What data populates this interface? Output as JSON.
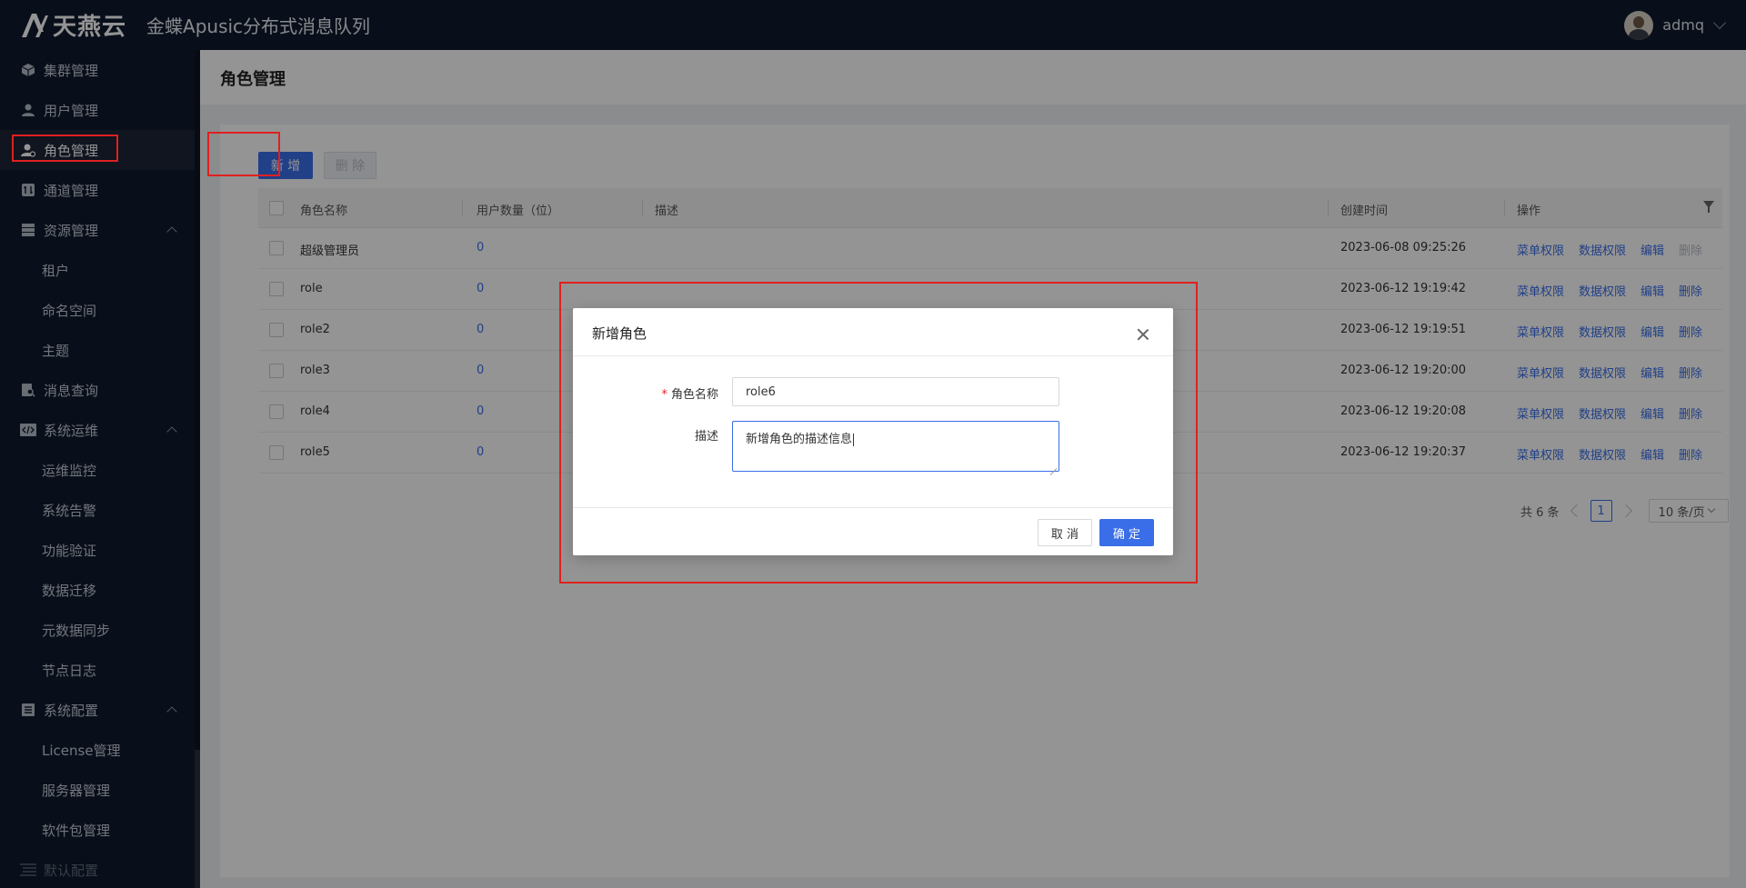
{
  "header": {
    "logo_text": "天燕云",
    "app_title": "金蝶Apusic分布式消息队列",
    "user_name": "admq"
  },
  "sidebar": {
    "items": [
      {
        "label": "集群管理",
        "icon": "cube-icon"
      },
      {
        "label": "用户管理",
        "icon": "user-icon"
      },
      {
        "label": "角色管理",
        "icon": "user-gear-icon"
      },
      {
        "label": "通道管理",
        "icon": "channel-icon"
      },
      {
        "label": "资源管理",
        "icon": "database-icon"
      },
      {
        "label": "租户"
      },
      {
        "label": "命名空间"
      },
      {
        "label": "主题"
      },
      {
        "label": "消息查询",
        "icon": "search-doc-icon"
      },
      {
        "label": "系统运维",
        "icon": "code-icon"
      },
      {
        "label": "运维监控"
      },
      {
        "label": "系统告警"
      },
      {
        "label": "功能验证"
      },
      {
        "label": "数据迁移"
      },
      {
        "label": "元数据同步"
      },
      {
        "label": "节点日志"
      },
      {
        "label": "系统配置",
        "icon": "list-icon"
      },
      {
        "label": "License管理"
      },
      {
        "label": "服务器管理"
      },
      {
        "label": "软件包管理"
      },
      {
        "label": "默认配置",
        "icon": "menu-icon"
      }
    ]
  },
  "page": {
    "title": "角色管理",
    "add_label": "新 增",
    "delete_label": "删 除"
  },
  "table": {
    "columns": [
      "角色名称",
      "用户数量（位）",
      "描述",
      "创建时间",
      "操作"
    ],
    "rows": [
      {
        "name": "超级管理员",
        "count": "0",
        "desc": "",
        "created": "2023-06-08 09:25:26",
        "ops": [
          "菜单权限",
          "数据权限",
          "编辑",
          "删除"
        ],
        "delete_disabled": true
      },
      {
        "name": "role",
        "count": "0",
        "desc": "",
        "created": "2023-06-12 19:19:42",
        "ops": [
          "菜单权限",
          "数据权限",
          "编辑",
          "删除"
        ],
        "delete_disabled": false
      },
      {
        "name": "role2",
        "count": "0",
        "desc": "",
        "created": "2023-06-12 19:19:51",
        "ops": [
          "菜单权限",
          "数据权限",
          "编辑",
          "删除"
        ],
        "delete_disabled": false
      },
      {
        "name": "role3",
        "count": "0",
        "desc": "",
        "created": "2023-06-12 19:20:00",
        "ops": [
          "菜单权限",
          "数据权限",
          "编辑",
          "删除"
        ],
        "delete_disabled": false
      },
      {
        "name": "role4",
        "count": "0",
        "desc": "",
        "created": "2023-06-12 19:20:08",
        "ops": [
          "菜单权限",
          "数据权限",
          "编辑",
          "删除"
        ],
        "delete_disabled": false
      },
      {
        "name": "role5",
        "count": "0",
        "desc": "",
        "created": "2023-06-12 19:20:37",
        "ops": [
          "菜单权限",
          "数据权限",
          "编辑",
          "删除"
        ],
        "delete_disabled": false
      }
    ]
  },
  "pagination": {
    "total": "共 6 条",
    "current": "1",
    "page_size": "10 条/页"
  },
  "modal": {
    "title": "新增角色",
    "name_label": "角色名称",
    "name_value": "role6",
    "desc_label": "描述",
    "desc_value": "新增角色的描述信息",
    "cancel_label": "取 消",
    "ok_label": "确 定"
  },
  "colors": {
    "primary": "#3a6ee8",
    "sidebar_bg": "#101a2e",
    "highlight": "#e02020"
  }
}
